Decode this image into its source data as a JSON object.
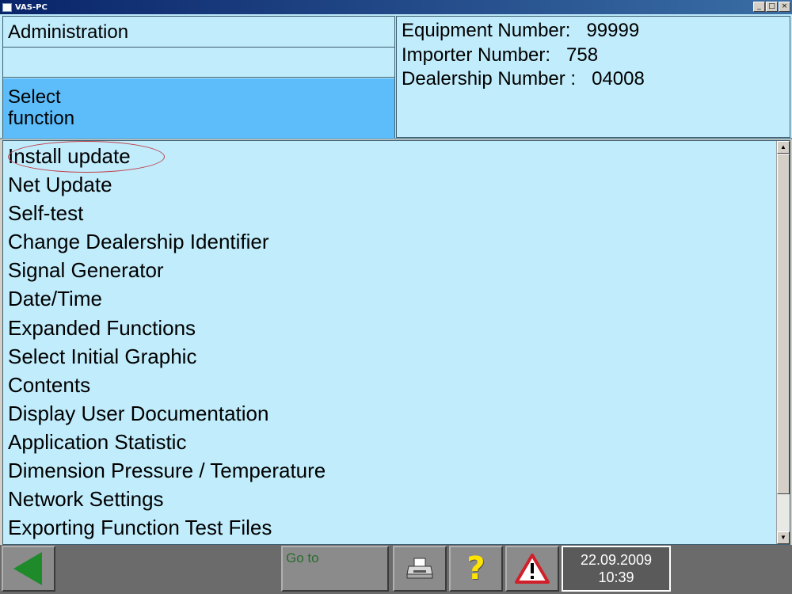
{
  "window": {
    "title": "VAS-PC",
    "buttons": [
      "minimize",
      "maximize",
      "close"
    ]
  },
  "header": {
    "title": "Administration",
    "select_line1": "Select",
    "select_line2": "function",
    "equipment_line": "Equipment Number:   99999",
    "importer_line": "Importer Number:   758",
    "dealership_line": "Dealership Number :   04008"
  },
  "menu": {
    "items": [
      "Install update",
      "Net Update",
      "Self-test",
      "Change Dealership Identifier",
      "Signal Generator",
      "Date/Time",
      "Expanded Functions",
      "Select Initial Graphic",
      "Contents",
      "Display User Documentation",
      "Application Statistic",
      "Dimension Pressure / Temperature",
      "Network Settings",
      "Exporting Function Test Files"
    ]
  },
  "toolbar": {
    "goto_label": "Go to",
    "date": "22.09.2009",
    "time": "10:39",
    "back_icon": "back-arrow-icon",
    "print_icon": "printer-icon",
    "help_icon": "help-icon",
    "help_glyph": "?",
    "warning_icon": "warning-icon"
  },
  "colors": {
    "panel_bg": "#c0ecfb",
    "select_bg": "#5cbdfa",
    "toolbar_bg": "#6b6b6b",
    "back_arrow": "#1e8a2a",
    "help_yellow": "#ffe400",
    "warning_red": "#d0202a"
  }
}
